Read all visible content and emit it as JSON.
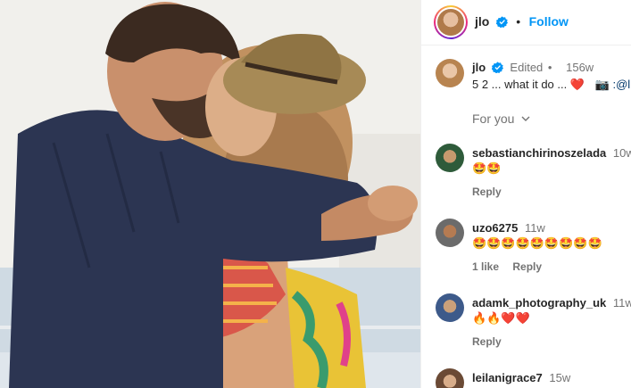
{
  "header": {
    "username": "jlo",
    "follow_label": "Follow",
    "separator": "•"
  },
  "caption": {
    "username": "jlo",
    "edited": "Edited",
    "separator": "•",
    "time": "156w",
    "text": "5 2 ... what it do ...",
    "heart": "❤️",
    "camera": "📷",
    "mention": ":@l"
  },
  "filter": {
    "label": "For you"
  },
  "comments": [
    {
      "username": "sebastianchirinoszelada",
      "time": "10w",
      "emojis": "🤩🤩",
      "likes": "",
      "reply": "Reply"
    },
    {
      "username": "uzo6275",
      "time": "11w",
      "emojis": "🤩🤩🤩🤩🤩🤩🤩🤩🤩",
      "likes": "1 like",
      "reply": "Reply"
    },
    {
      "username": "adamk_photography_uk",
      "time": "11w",
      "emojis": "🔥🔥❤️❤️",
      "likes": "",
      "reply": "Reply"
    },
    {
      "username": "leilanigrace7",
      "time": "15w",
      "emojis": "",
      "likes": "",
      "reply": ""
    }
  ],
  "colors": {
    "link_blue": "#0095f6",
    "verified_blue": "#0095f6",
    "text_primary": "#262626",
    "text_secondary": "#737373"
  },
  "icons": {
    "verified": "verified-badge-icon",
    "chevron": "chevron-down-icon"
  }
}
